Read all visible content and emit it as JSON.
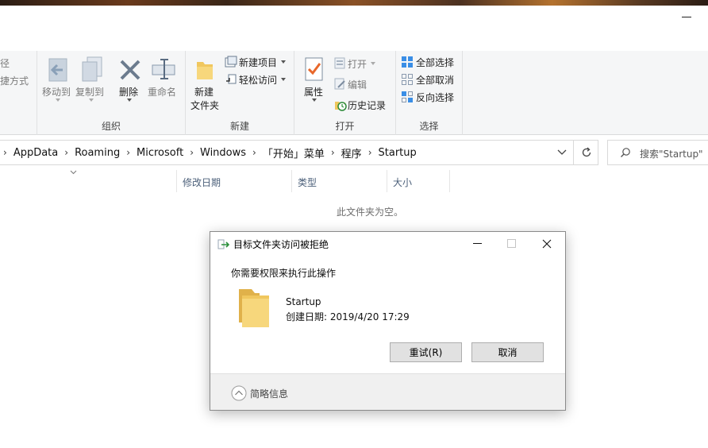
{
  "ribbon": {
    "clipboard_partial": {
      "path_label": "径",
      "shortcut_label": "捷方式"
    },
    "organize": {
      "label": "组织",
      "move_to": "移动到",
      "copy_to": "复制到",
      "delete": "删除",
      "rename": "重命名"
    },
    "new": {
      "label": "新建",
      "new_folder_line1": "新建",
      "new_folder_line2": "文件夹",
      "new_item": "新建项目",
      "easy_access": "轻松访问"
    },
    "open": {
      "label": "打开",
      "properties": "属性",
      "open": "打开",
      "edit": "编辑",
      "history": "历史记录"
    },
    "select": {
      "label": "选择",
      "select_all": "全部选择",
      "select_none": "全部取消",
      "invert": "反向选择"
    }
  },
  "address": {
    "crumbs": [
      "AppData",
      "Roaming",
      "Microsoft",
      "Windows",
      "「开始」菜单",
      "程序",
      "Startup"
    ]
  },
  "search": {
    "placeholder": "搜索\"Startup\""
  },
  "columns": {
    "modified": "修改日期",
    "type": "类型",
    "size": "大小"
  },
  "content": {
    "empty": "此文件夹为空。"
  },
  "dialog": {
    "title": "目标文件夹访问被拒绝",
    "message": "你需要权限来执行此操作",
    "folder_name": "Startup",
    "created": "创建日期: 2019/4/20 17:29",
    "retry": "重试(R)",
    "cancel": "取消",
    "details": "简略信息"
  },
  "colors": {
    "accent": "#0078d7",
    "folder": "#f0c75e",
    "button_bg": "#e1e1e1"
  }
}
